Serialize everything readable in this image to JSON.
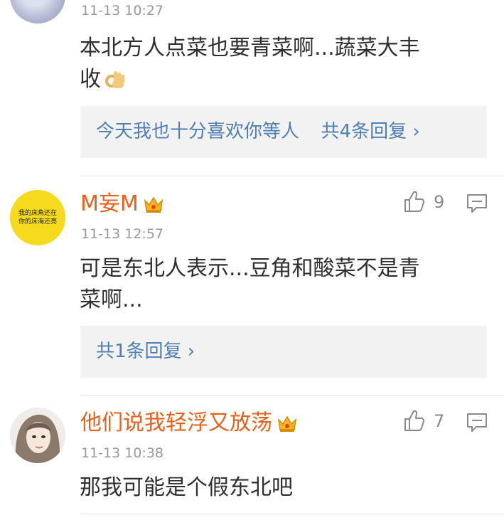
{
  "comments": [
    {
      "time": "11-13 10:27",
      "text_line1": "本北方人点菜也要青菜啊...蔬菜大丰",
      "text_line2": "收",
      "reply_link": "今天我也十分喜欢你等人",
      "reply_count": "共4条回复 ›"
    },
    {
      "username": "M妄M",
      "avatar_text_line1": "我的床角还在",
      "avatar_text_line2": "你的床海还亮",
      "time": "11-13 12:57",
      "likes": "9",
      "text_line1": "可是东北人表示...豆角和酸菜不是青",
      "text_line2": "菜啊...",
      "reply_count": "共1条回复 ›"
    },
    {
      "username": "他们说我轻浮又放荡",
      "time": "11-13 10:38",
      "likes": "7",
      "text_line1": "那我可能是个假东北吧"
    }
  ],
  "icons": [
    "thumbs-up-icon",
    "comment-icon",
    "crown-icon",
    "ok-hand-emoji"
  ],
  "colors": {
    "username": "#e8611c",
    "link": "#4f7fb3",
    "reply_bg": "#f2f2f2",
    "timestamp": "#9a9a9a"
  }
}
